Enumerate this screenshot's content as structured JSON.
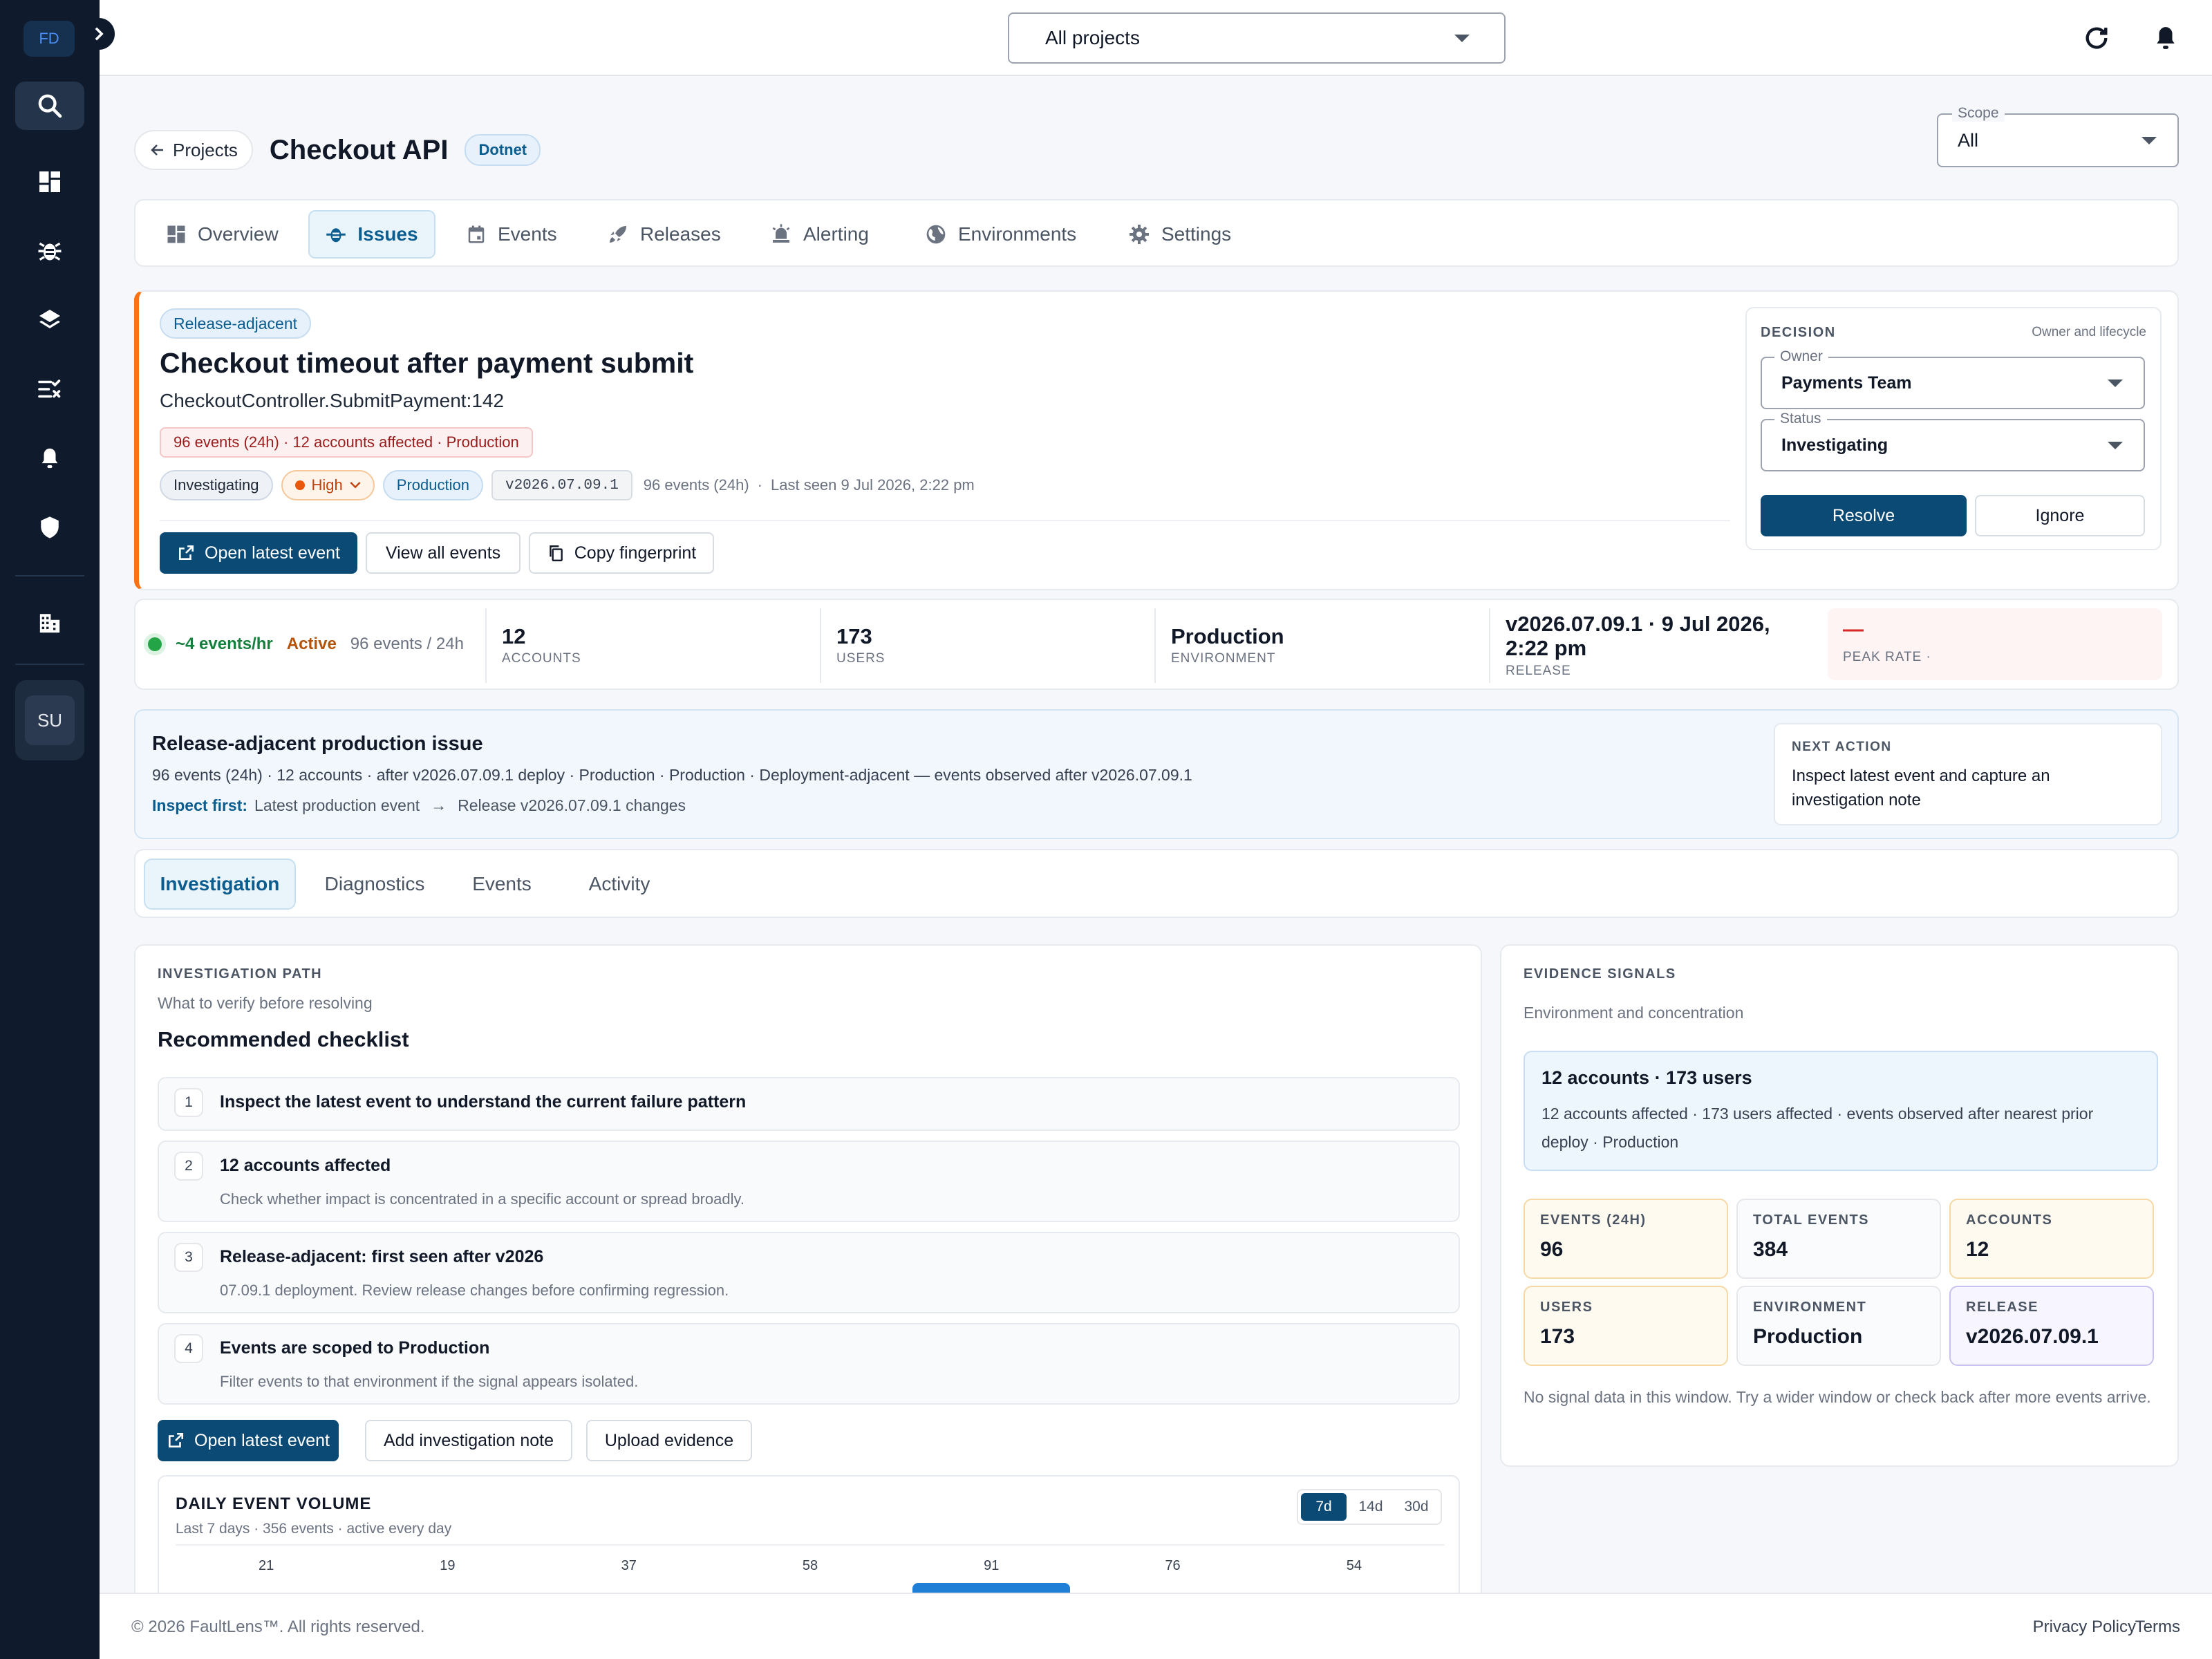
{
  "sidebar": {
    "logo": "FD",
    "items": [
      {
        "icon": "search-icon"
      },
      {
        "icon": "dashboard-icon"
      },
      {
        "icon": "bug-icon"
      },
      {
        "icon": "layers-icon"
      },
      {
        "icon": "checklist-icon"
      },
      {
        "icon": "bell-icon"
      },
      {
        "icon": "shield-icon"
      },
      {
        "icon": "building-icon"
      }
    ],
    "avatar": "SU"
  },
  "topbar": {
    "project_selector": "All projects"
  },
  "header": {
    "back_label": "Projects",
    "title": "Checkout API",
    "platform_badge": "Dotnet",
    "scope_label": "Scope",
    "scope_value": "All"
  },
  "nav_tabs": [
    {
      "label": "Overview",
      "icon": "grid-icon"
    },
    {
      "label": "Issues",
      "icon": "bug-icon"
    },
    {
      "label": "Events",
      "icon": "calendar-icon"
    },
    {
      "label": "Releases",
      "icon": "rocket-icon"
    },
    {
      "label": "Alerting",
      "icon": "alarm-icon"
    },
    {
      "label": "Environments",
      "icon": "globe-icon"
    },
    {
      "label": "Settings",
      "icon": "gear-icon"
    }
  ],
  "issue": {
    "category_tag": "Release-adjacent",
    "title": "Checkout timeout after payment submit",
    "location": "CheckoutController.SubmitPayment:142",
    "impact_badge": "96 events (24h) · 12 accounts affected · Production",
    "status_tag": "Investigating",
    "priority_tag": "High",
    "environment_tag": "Production",
    "release_tag": "v2026.07.09.1",
    "events_24h": "96 events (24h)",
    "last_seen": "Last seen 9 Jul 2026, 2:22 pm",
    "actions": {
      "open_latest": "Open latest event",
      "view_all": "View all events",
      "copy_fingerprint": "Copy fingerprint"
    }
  },
  "decision": {
    "heading": "DECISION",
    "subheading": "Owner and lifecycle",
    "owner_label": "Owner",
    "owner_value": "Payments Team",
    "status_label": "Status",
    "status_value": "Investigating",
    "resolve": "Resolve",
    "ignore": "Ignore"
  },
  "stats": {
    "rate": "~4 events/hr",
    "activity": "Active",
    "events_24h": "96 events / 24h",
    "accounts_value": "12",
    "accounts_label": "ACCOUNTS",
    "users_value": "173",
    "users_label": "USERS",
    "environment_value": "Production",
    "environment_label": "ENVIRONMENT",
    "release_value": "v2026.07.09.1 · 9 Jul 2026, 2:22 pm",
    "release_label": "RELEASE",
    "peak_value": "—",
    "peak_label": "PEAK RATE ·"
  },
  "summary": {
    "title": "Release-adjacent production issue",
    "detail": "96 events (24h) · 12 accounts · after v2026.07.09.1 deploy · Production · Production · Deployment-adjacent — events observed after v2026.07.09.1",
    "inspect_label": "Inspect first:",
    "inspect_step1": "Latest production event",
    "arrow": "→",
    "inspect_step2": "Release v2026.07.09.1 changes",
    "next_action_label": "NEXT ACTION",
    "next_action_text": "Inspect latest event and capture an investigation note"
  },
  "detail_tabs": [
    "Investigation",
    "Diagnostics",
    "Events",
    "Activity"
  ],
  "investigation": {
    "kicker": "INVESTIGATION PATH",
    "subtitle": "What to verify before resolving",
    "title": "Recommended checklist",
    "checklist": [
      {
        "num": "1",
        "title": "Inspect the latest event to understand the current failure pattern",
        "desc": ""
      },
      {
        "num": "2",
        "title": "12 accounts affected",
        "desc": "Check whether impact is concentrated in a specific account or spread broadly."
      },
      {
        "num": "3",
        "title": "Release-adjacent: first seen after v2026",
        "desc": "07.09.1 deployment. Review release changes before confirming regression."
      },
      {
        "num": "4",
        "title": "Events are scoped to Production",
        "desc": "Filter events to that environment if the signal appears isolated."
      }
    ],
    "actions": {
      "open_latest": "Open latest event",
      "add_note": "Add investigation note",
      "upload": "Upload evidence"
    }
  },
  "volume": {
    "title": "DAILY EVENT VOLUME",
    "subtitle": "Last 7 days · 356 events · active every day",
    "ranges": [
      "7d",
      "14d",
      "30d"
    ]
  },
  "chart_data": {
    "type": "bar",
    "title": "DAILY EVENT VOLUME",
    "categories": [
      "",
      "",
      "",
      "",
      "",
      "",
      ""
    ],
    "values": [
      21,
      19,
      37,
      58,
      91,
      76,
      54
    ],
    "highlight_index": 4
  },
  "evidence": {
    "kicker": "EVIDENCE SIGNALS",
    "subtitle": "Environment and concentration",
    "highlight_title": "12 accounts · 173 users",
    "highlight_text": "12 accounts affected · 173 users affected · events observed after nearest prior deploy · Production",
    "tiles": [
      {
        "label": "EVENTS (24H)",
        "value": "96"
      },
      {
        "label": "TOTAL EVENTS",
        "value": "384"
      },
      {
        "label": "ACCOUNTS",
        "value": "12"
      },
      {
        "label": "USERS",
        "value": "173"
      },
      {
        "label": "ENVIRONMENT",
        "value": "Production"
      },
      {
        "label": "RELEASE",
        "value": "v2026.07.09.1"
      }
    ],
    "empty_note": "No signal data in this window. Try a wider window or check back after more events arrive."
  },
  "footer": {
    "copyright": "© 2026 FaultLens™. All rights reserved.",
    "privacy": "Privacy Policy",
    "separator": "·",
    "terms": "Terms"
  },
  "colors": {
    "primary": "#0b4a74",
    "accent_orange": "#f97316",
    "sidebar": "#0f1b2d",
    "active_green": "#22a447",
    "chart_highlight": "#1f7fd6"
  }
}
